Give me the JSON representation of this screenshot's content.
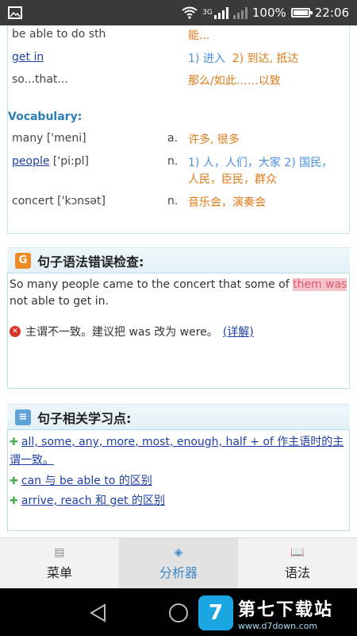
{
  "status_bar": {
    "signal_type": "3G",
    "battery": "100%",
    "battery_level": 1.0,
    "time": "22:06"
  },
  "phrases": [
    {
      "en": "be able to do sth",
      "zh": "能..."
    },
    {
      "en": "get in",
      "zh_1": "1) 进入",
      "zh_2": "2) 到达, 抵达"
    },
    {
      "en": "so...that...",
      "zh": "那么/如此……以致"
    }
  ],
  "vocabulary": {
    "title": "Vocabulary:",
    "items": [
      {
        "word": "many ['meni]",
        "pos": "a.",
        "zh": "许多, 很多"
      },
      {
        "word": "people",
        "phonetic": "['pi:pl]",
        "pos": "n.",
        "zh_1a": "1) 人，人们，大家",
        "zh_2a": "2) 国民，",
        "zh_2b": "人民，臣民，群众"
      },
      {
        "word": "concert ['kɔnsət]",
        "pos": "n.",
        "zh": "音乐会，演奏会"
      }
    ]
  },
  "grammar_check": {
    "title": "句子语法错误检查:",
    "sentence_before": "So many people came to the concert that some of ",
    "sentence_highlight": "them was",
    "sentence_after": " not able to get in.",
    "error_text": "主谓不一致。建议把 was 改为 were。",
    "detail_link": "(详解)"
  },
  "learning_points": {
    "title": "句子相关学习点:",
    "items": [
      "all, some, any, more, most, enough, half + of 作主语时的主谓一致。",
      "can 与 be able to 的区别",
      "arrive, reach 和 get 的区别"
    ]
  },
  "tabs": [
    {
      "label": "菜单",
      "icon": "list-icon"
    },
    {
      "label": "分析器",
      "icon": "layers-icon"
    },
    {
      "label": "语法",
      "icon": "book-icon"
    }
  ],
  "watermark": {
    "logo_letter": "7",
    "name": "第七下载站",
    "url": "www.d7down.com"
  }
}
